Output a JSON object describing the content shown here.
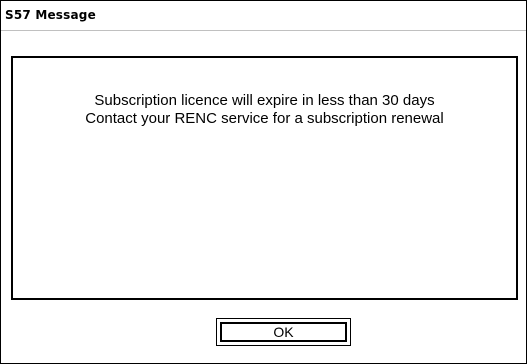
{
  "dialog": {
    "title": "S57 Message",
    "message_lines": [
      "Subscription licence will expire in less than 30 days",
      "Contact your RENC service for a subscription renewal"
    ],
    "ok_label": "OK"
  }
}
